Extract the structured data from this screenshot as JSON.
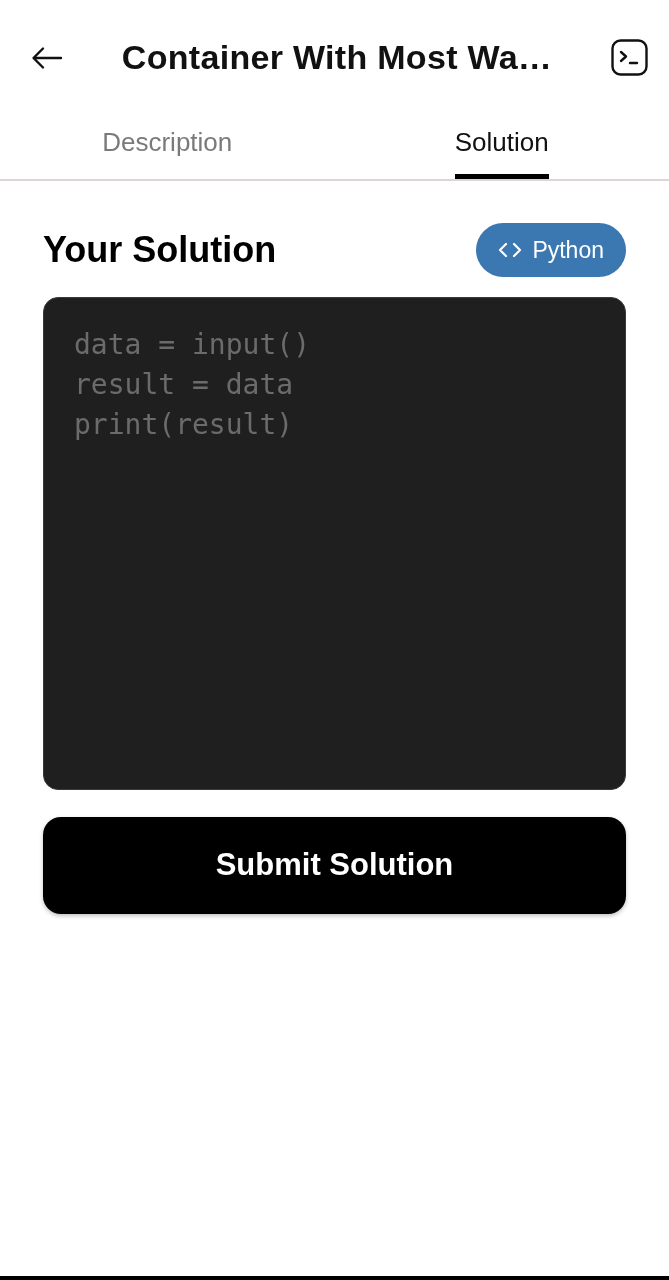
{
  "header": {
    "title": "Container With Most Wa…"
  },
  "tabs": [
    {
      "label": "Description",
      "selected": false
    },
    {
      "label": "Solution",
      "selected": true
    }
  ],
  "solution": {
    "heading": "Your Solution",
    "language": "Python",
    "editor": {
      "placeholder": "data = input()\nresult = data\nprint(result)"
    }
  },
  "submit_button": {
    "label": "Submit Solution"
  }
}
